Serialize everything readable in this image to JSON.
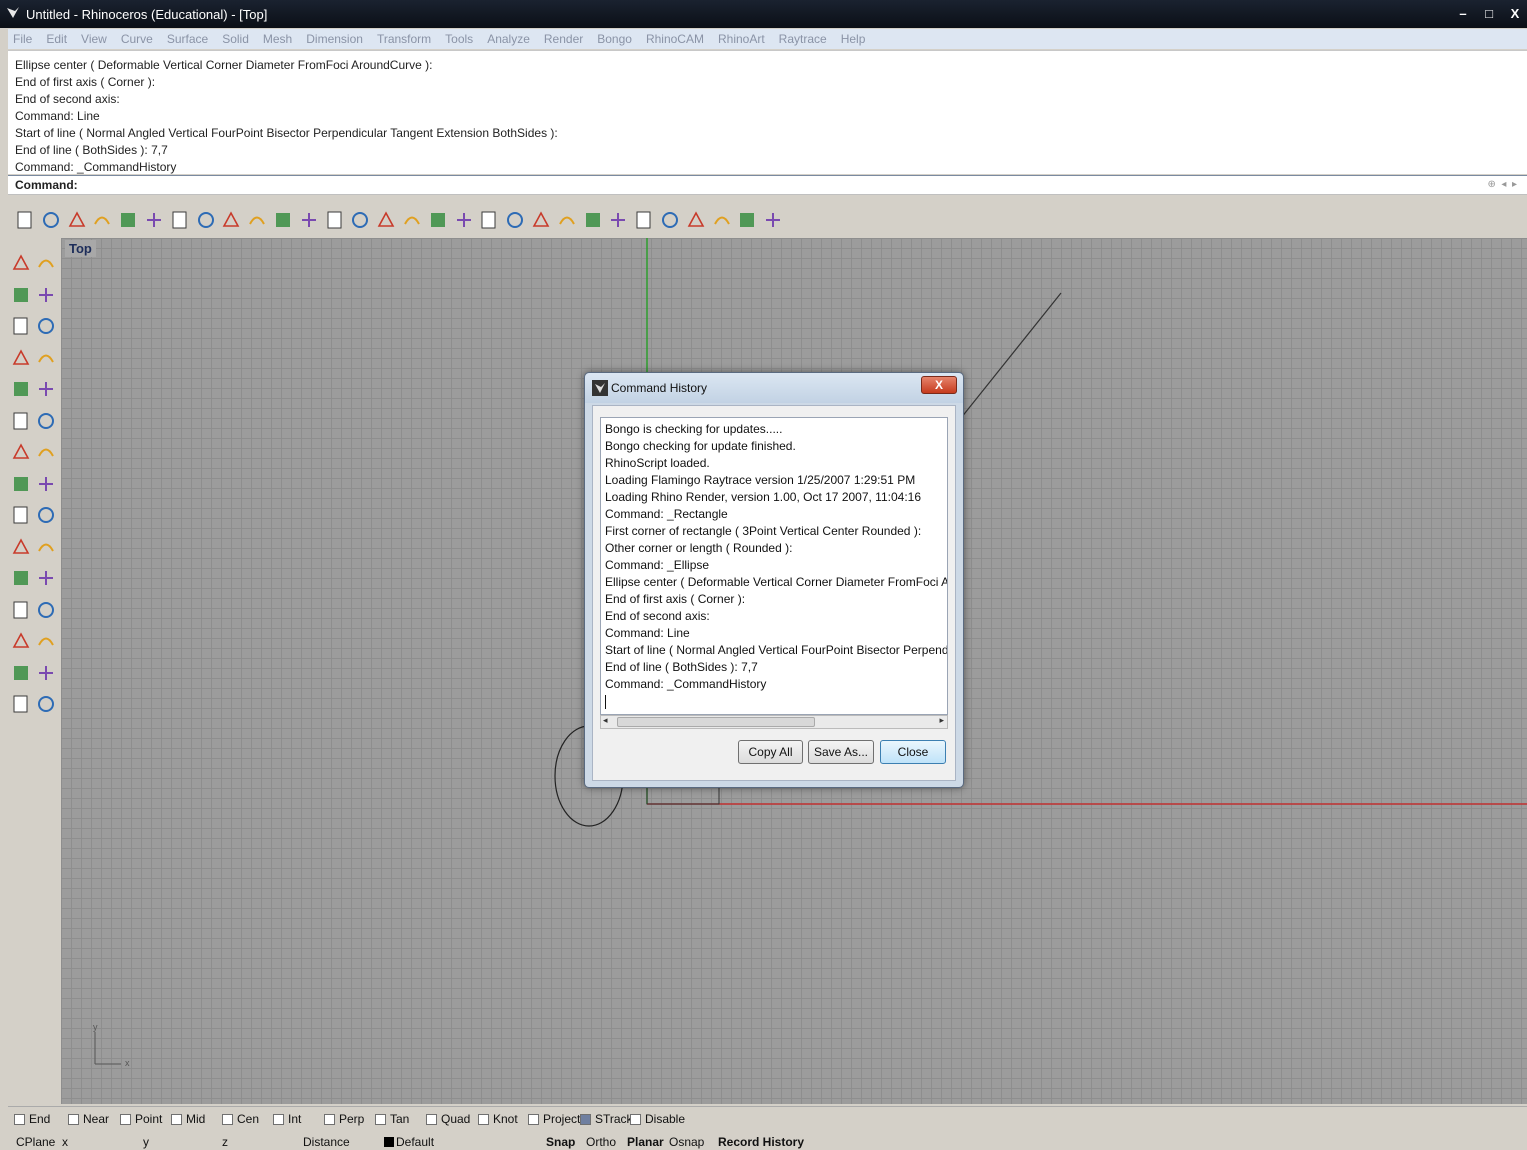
{
  "window": {
    "title": "Untitled - Rhinoceros (Educational) - [Top]",
    "controls": {
      "minimize": "–",
      "maximize": "□",
      "close": "X"
    }
  },
  "menu": [
    "File",
    "Edit",
    "View",
    "Curve",
    "Surface",
    "Solid",
    "Mesh",
    "Dimension",
    "Transform",
    "Tools",
    "Analyze",
    "Render",
    "Bongo",
    "RhinoCAM",
    "RhinoArt",
    "Raytrace",
    "Help"
  ],
  "command_history": [
    "Ellipse center ( Deformable  Vertical  Corner  Diameter  FromFoci  AroundCurve ):",
    "End of first axis ( Corner ):",
    "End of second axis:",
    "Command: Line",
    "Start of line ( Normal  Angled  Vertical  FourPoint  Bisector  Perpendicular  Tangent  Extension  BothSides ):",
    "End of line ( BothSides ): 7,7",
    "Command: _CommandHistory"
  ],
  "command_prompt": "Command:",
  "viewport": {
    "label": "Top"
  },
  "dialog": {
    "title": "Command History",
    "close_glyph": "X",
    "lines": [
      "Bongo is checking for updates.....",
      "Bongo checking for update finished.",
      "RhinoScript loaded.",
      "Loading Flamingo Raytrace version 1/25/2007 1:29:51 PM",
      "Loading Rhino Render, version 1.00, Oct 17 2007, 11:04:16",
      "Command: _Rectangle",
      "First corner of rectangle ( 3Point  Vertical  Center  Rounded ):",
      "Other corner or length ( Rounded ):",
      "Command: _Ellipse",
      "Ellipse center ( Deformable  Vertical  Corner  Diameter  FromFoci  Ar",
      "End of first axis ( Corner ):",
      "End of second axis:",
      "Command: Line",
      "Start of line ( Normal  Angled  Vertical  FourPoint  Bisector  Perpendic",
      "End of line ( BothSides ): 7,7",
      "Command: _CommandHistory"
    ],
    "buttons": {
      "copy_all": "Copy All",
      "save_as": "Save As...",
      "close": "Close"
    }
  },
  "osnaps": [
    {
      "label": "End",
      "checked": false
    },
    {
      "label": "Near",
      "checked": false
    },
    {
      "label": "Point",
      "checked": false
    },
    {
      "label": "Mid",
      "checked": false
    },
    {
      "label": "Cen",
      "checked": false
    },
    {
      "label": "Int",
      "checked": false
    },
    {
      "label": "Perp",
      "checked": false
    },
    {
      "label": "Tan",
      "checked": false
    },
    {
      "label": "Quad",
      "checked": false
    },
    {
      "label": "Knot",
      "checked": false
    },
    {
      "label": "Project",
      "checked": false
    },
    {
      "label": "STrack",
      "checked": true
    },
    {
      "label": "Disable",
      "checked": false
    }
  ],
  "status": {
    "cplane": "CPlane",
    "x": "x",
    "y": "y",
    "z": "z",
    "distance": "Distance",
    "layer": "Default",
    "snap": "Snap",
    "ortho": "Ortho",
    "planar": "Planar",
    "osnap": "Osnap",
    "record_history": "Record History"
  },
  "colors": {
    "x_axis": "#c03030",
    "y_axis": "#2e9e2e",
    "grid": "#8e8e8e",
    "viewport_bg": "#9c9c9c"
  },
  "toolbar_icons": [
    "new-icon",
    "open-icon",
    "save-icon",
    "print-icon",
    "properties-icon",
    "cut-icon",
    "copy-icon",
    "paste-icon",
    "undo-icon",
    "pan-icon",
    "move-icon",
    "zoom-icon",
    "zoom-window-icon",
    "zoom-extents-icon",
    "zoom-selected-icon",
    "rotate-view-icon",
    "viewport-layout-icon",
    "car-icon",
    "grid-icon",
    "target-icon",
    "trace-icon",
    "light-icon",
    "lock-icon",
    "shade-icon",
    "render-color-icon",
    "render-icon",
    "sphere-icon",
    "settings-icon",
    "layers-icon",
    "help-icon"
  ],
  "left_tool_icons": [
    "select-icon",
    "point-icon",
    "polyline-icon",
    "curve-icon",
    "circle-icon",
    "arc-icon",
    "rectangle-icon",
    "square-icon",
    "ellipse-icon",
    "fillet-icon",
    "surface-icon",
    "loft-icon",
    "solid-box-icon",
    "solid-union-icon",
    "cylinder-icon",
    "extrude-icon",
    "transform-icon",
    "lightning-icon",
    "dimension-icon",
    "ruler-icon",
    "drop-icon",
    "split-icon",
    "curve-tool-icon",
    "offset-icon",
    "text-icon",
    "snap-icon",
    "array-icon",
    "mirror-icon",
    "mesh-icon",
    "analyze-icon"
  ]
}
